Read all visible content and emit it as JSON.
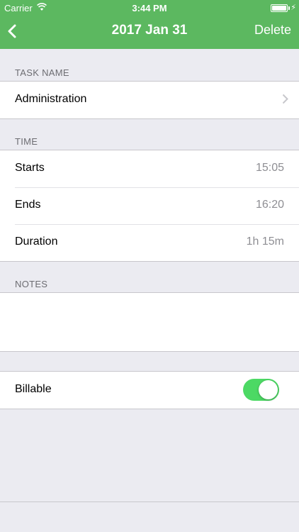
{
  "status_bar": {
    "carrier": "Carrier",
    "time": "3:44 PM",
    "battery_level": 1.0
  },
  "nav": {
    "title": "2017 Jan 31",
    "right_action": "Delete"
  },
  "task_section": {
    "header": "TASK NAME",
    "value": "Administration"
  },
  "time_section": {
    "header": "TIME",
    "rows": [
      {
        "label": "Starts",
        "value": "15:05"
      },
      {
        "label": "Ends",
        "value": "16:20"
      },
      {
        "label": "Duration",
        "value": "1h 15m"
      }
    ]
  },
  "notes_section": {
    "header": "NOTES",
    "value": ""
  },
  "billable": {
    "label": "Billable",
    "on": true
  },
  "colors": {
    "nav_green": "#5cb860",
    "toggle_green": "#4cd964",
    "background": "#ebebf1"
  }
}
